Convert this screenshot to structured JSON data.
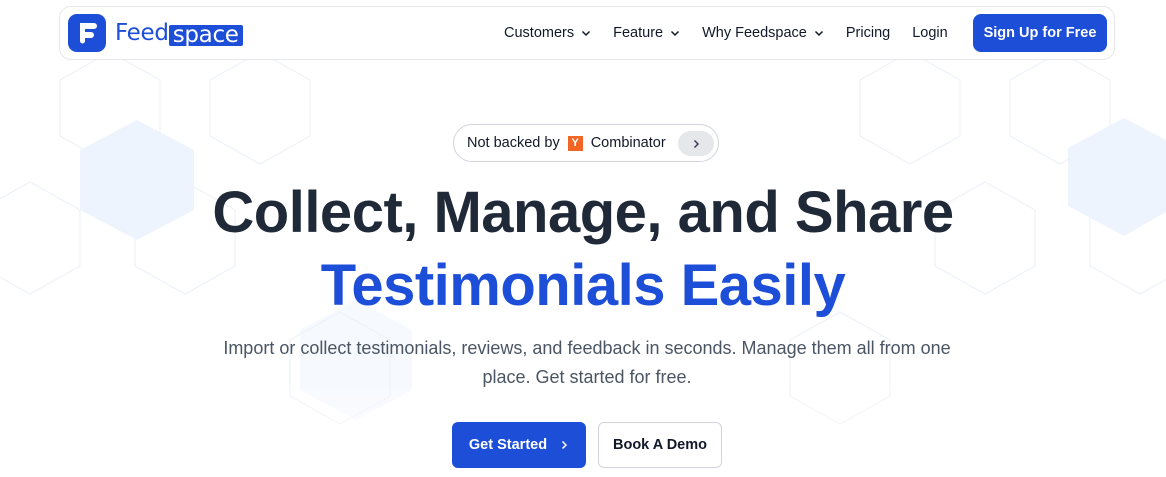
{
  "brand": {
    "name_part1": "Feed",
    "name_part2": "space",
    "logo_icon": "feedspace-logo-icon",
    "accent_color": "#1d4ed8"
  },
  "nav": {
    "items": [
      {
        "label": "Customers",
        "has_dropdown": true
      },
      {
        "label": "Feature",
        "has_dropdown": true
      },
      {
        "label": "Why Feedspace",
        "has_dropdown": true
      },
      {
        "label": "Pricing",
        "has_dropdown": false
      },
      {
        "label": "Login",
        "has_dropdown": false
      }
    ],
    "signup_label": "Sign Up for Free"
  },
  "badge": {
    "text_before": "Not backed by",
    "logo_letter": "Y",
    "text_after": "Combinator",
    "arrow_icon": "chevron-right-icon"
  },
  "hero": {
    "headline_line1": "Collect, Manage, and Share",
    "headline_line2": "Testimonials Easily",
    "subtext": "Import or collect testimonials, reviews, and feedback in seconds. Manage them all from one place. Get started for free.",
    "primary_cta": "Get Started",
    "secondary_cta": "Book A Demo"
  }
}
